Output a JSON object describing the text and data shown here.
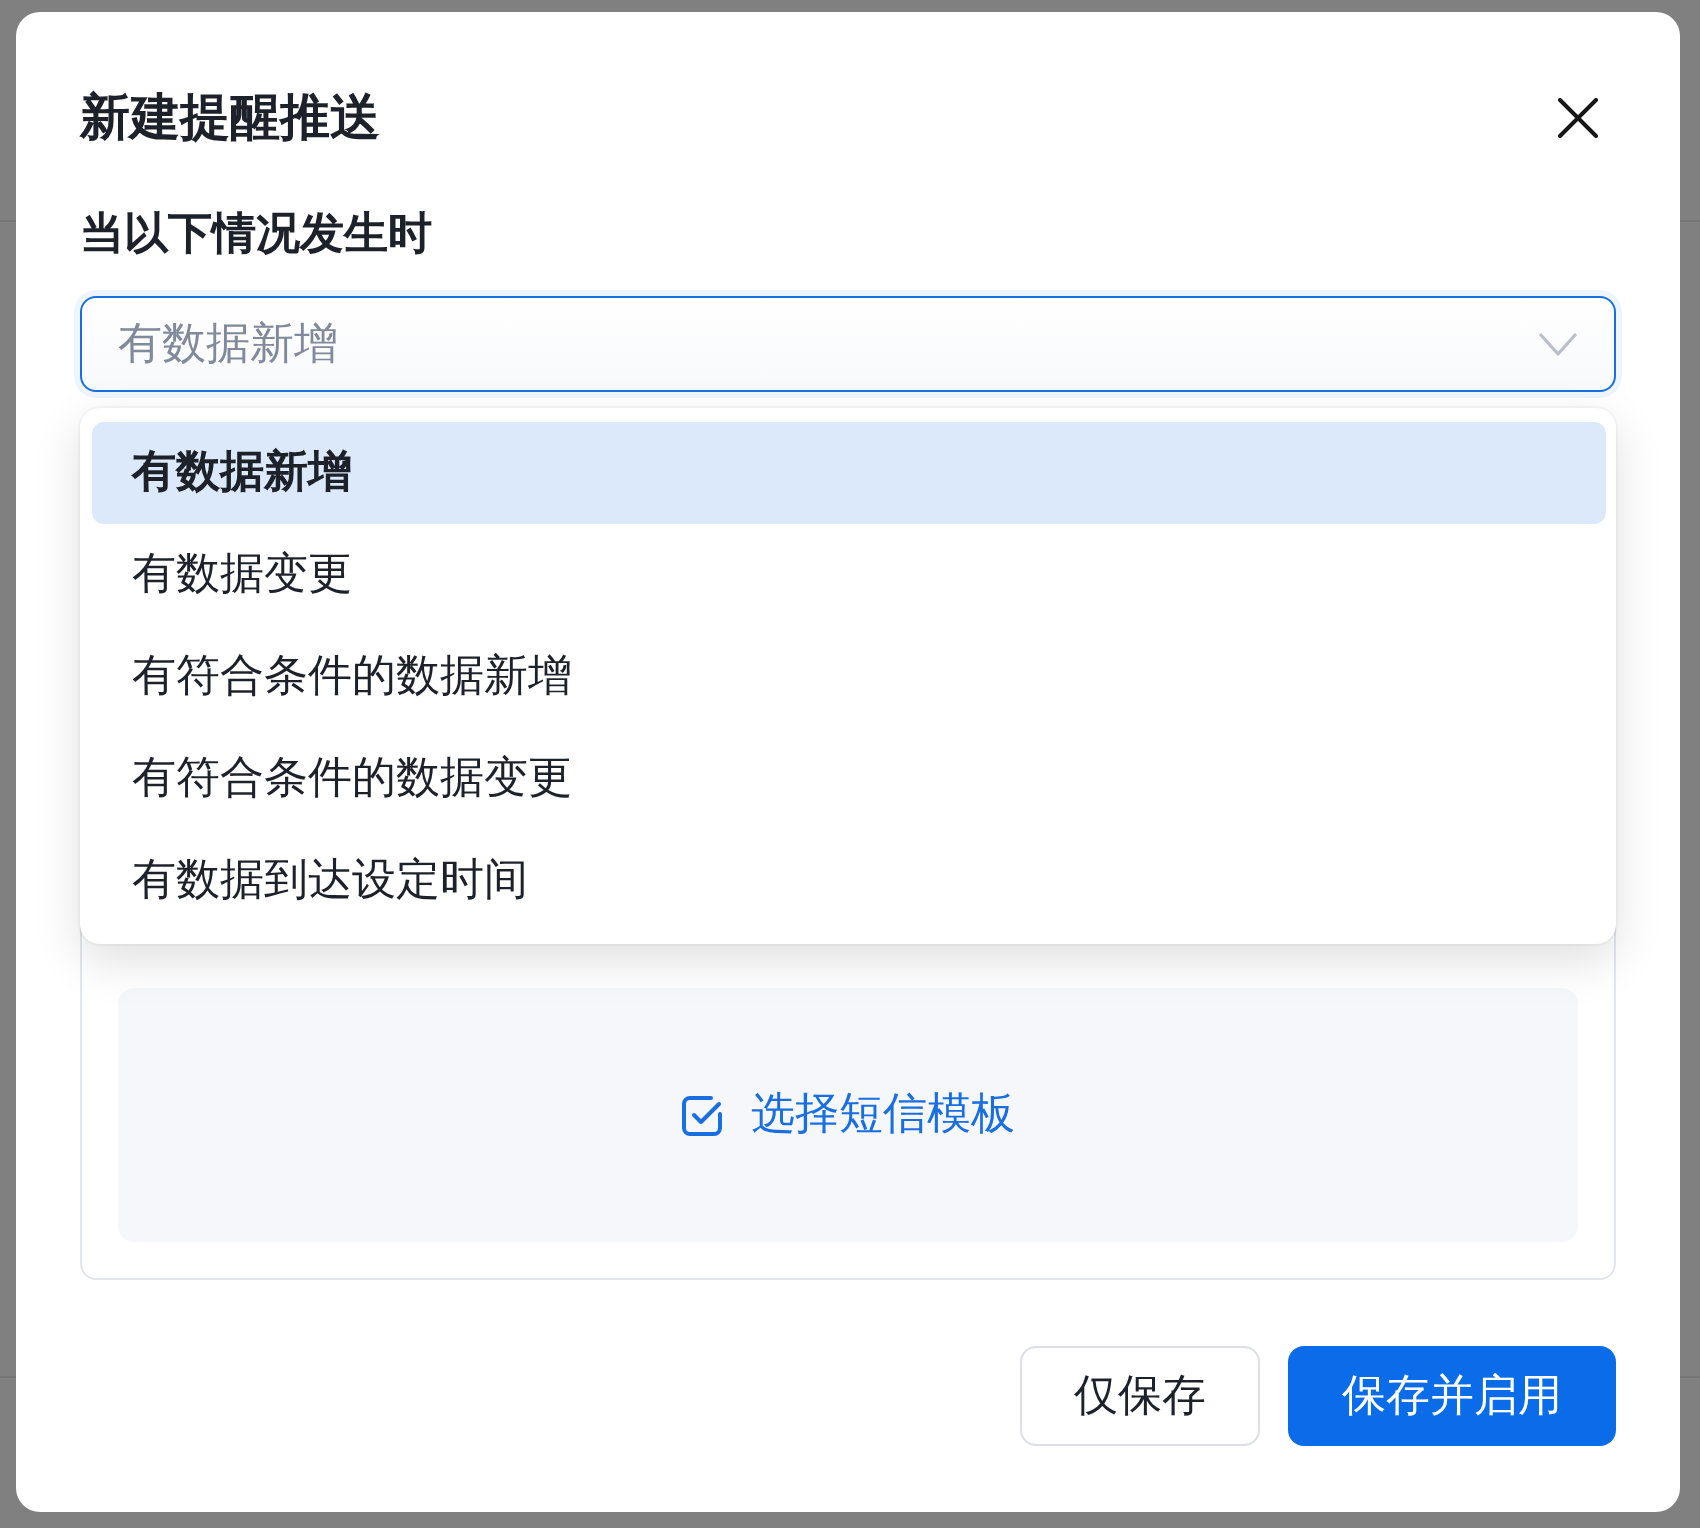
{
  "dialog": {
    "title": "新建提醒推送"
  },
  "trigger": {
    "label": "当以下情况发生时",
    "value": "有数据新增",
    "open": true,
    "options": [
      {
        "label": "有数据新增",
        "selected": true
      },
      {
        "label": "有数据变更",
        "selected": false
      },
      {
        "label": "有符合条件的数据新增",
        "selected": false
      },
      {
        "label": "有符合条件的数据变更",
        "selected": false
      },
      {
        "label": "有数据到达设定时间",
        "selected": false
      }
    ]
  },
  "sms_template": {
    "action": "选择短信模板"
  },
  "buttons": [
    {
      "label": "仅保存",
      "kind": "secondary"
    },
    {
      "label": "保存并启用",
      "kind": "primary"
    }
  ]
}
